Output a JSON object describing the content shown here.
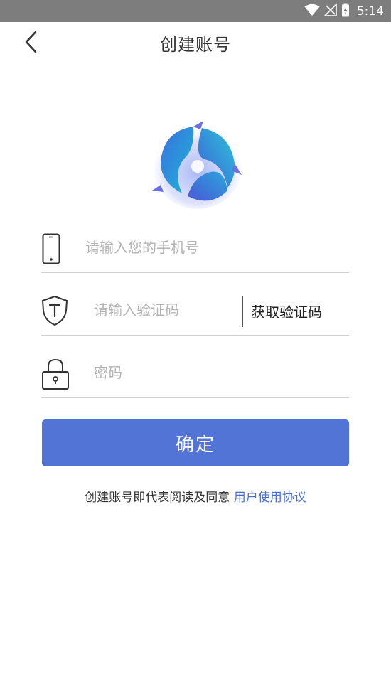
{
  "status_bar": {
    "time": "5:14",
    "icons": [
      "wifi-icon",
      "no-signal-icon",
      "battery-charging-icon"
    ]
  },
  "header": {
    "back_icon": "chevron-left-icon",
    "title": "创建账号"
  },
  "logo": {
    "icon": "app-logo-icon"
  },
  "form": {
    "phone": {
      "icon": "phone-icon",
      "placeholder": "请输入您的手机号",
      "value": ""
    },
    "code": {
      "icon": "shield-t-icon",
      "placeholder": "请输入验证码",
      "value": "",
      "get_code_label": "获取验证码"
    },
    "password": {
      "icon": "lock-icon",
      "placeholder": "密码",
      "value": ""
    }
  },
  "confirm_label": "确定",
  "agreement": {
    "prefix": "创建账号即代表阅读及同意 ",
    "link": "用户使用协议"
  },
  "colors": {
    "status_bar": "#7d7d7d",
    "primary": "#5174d6",
    "link": "#4a6fd6"
  }
}
